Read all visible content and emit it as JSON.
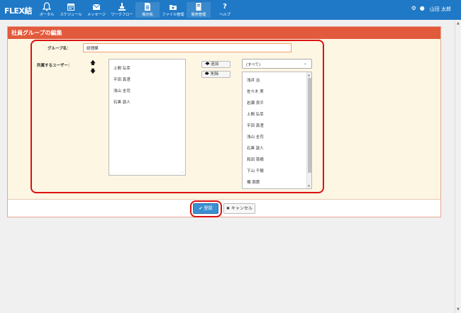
{
  "app": {
    "brand": "FLEX結"
  },
  "nav": [
    {
      "label": "ポータル",
      "icon": "bell-icon"
    },
    {
      "label": "スケジュール",
      "icon": "calendar-icon"
    },
    {
      "label": "メッセージ",
      "icon": "envelope-icon"
    },
    {
      "label": "ワークフロー",
      "icon": "workflow-icon"
    },
    {
      "label": "掲示板",
      "icon": "document-icon"
    },
    {
      "label": "ファイル管理",
      "icon": "folder-icon"
    },
    {
      "label": "販売管理",
      "icon": "form-icon"
    },
    {
      "label": "ヘルプ",
      "icon": "question-icon"
    }
  ],
  "user": {
    "name": "山田 太郎"
  },
  "panel": {
    "title": "社員グループの編集"
  },
  "form": {
    "group_label": "グループ名：",
    "group_value": "経理課",
    "members_label": "所属するユーザー："
  },
  "members": [
    "上間 弘幸",
    "平田 真澄",
    "浅山 圭司",
    "石黒 敦人"
  ],
  "buttons": {
    "add": "追加",
    "remove": "削除",
    "save": "登録",
    "cancel": "キャンセル"
  },
  "filter": {
    "selected": "(すべて)"
  },
  "candidates": [
    "浅井 治",
    "佐々木 実",
    "岩瀬 良平",
    "上間 弘幸",
    "平田 真澄",
    "浅山 圭司",
    "石黒 敦人",
    "和田 菜摘",
    "下山 千穂",
    "橋 朋惠"
  ]
}
